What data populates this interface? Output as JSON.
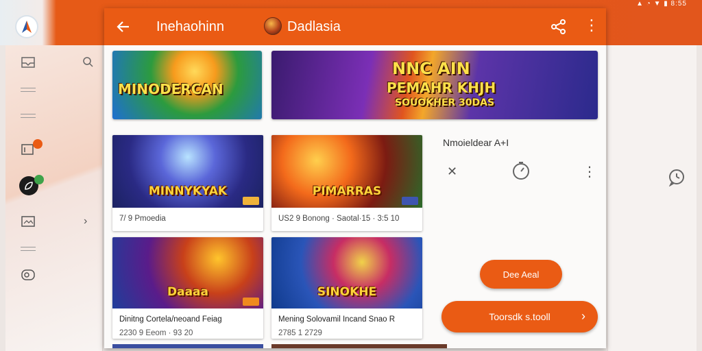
{
  "status_bar": {
    "text": "▲ ◔ ▼ ▮ 8:55"
  },
  "app_bar": {
    "title": "Inehaohinn",
    "game_title": "Dadlasia",
    "back_icon": "arrow-left-icon",
    "share_icon": "share-icon",
    "more_icon": "more-vert-icon"
  },
  "banners": [
    {
      "text": "MINODERCAN",
      "subtext": ""
    },
    {
      "line1": "NNC AIN",
      "line2": "PEMAHR KHJH",
      "line3": "SOUOKHER 30DAS"
    }
  ],
  "cards": [
    {
      "thumb_text": "MINNYKYAK",
      "meta": "7/ 9 Pmoedia",
      "meta2": ""
    },
    {
      "thumb_text": "PIMARRAS",
      "meta": "US2 9 Bonong · Saotal·15 · 3:5 10",
      "meta2": ""
    },
    {
      "thumb_text": "Daaaa",
      "meta": "Dinitng Cortela/neoand Feiag",
      "meta2": "2230 9 Eeom · 93 20"
    },
    {
      "thumb_text": "SINOKHE",
      "meta": "Mening Solovamil Incand Snao R",
      "meta2": "2785 1 2729"
    }
  ],
  "right_panel": {
    "title": "Nmoieldear A+I",
    "close_icon": "close-icon",
    "timer_icon": "stopwatch-icon",
    "more_icon": "more-vert-icon",
    "primary_button": "Dee Aeal",
    "secondary_button": "Toorsdk s.tooll",
    "chevron_icon": "chevron-right-icon"
  },
  "colors": {
    "accent": "#ea5b14",
    "background": "#fbfaf9"
  }
}
